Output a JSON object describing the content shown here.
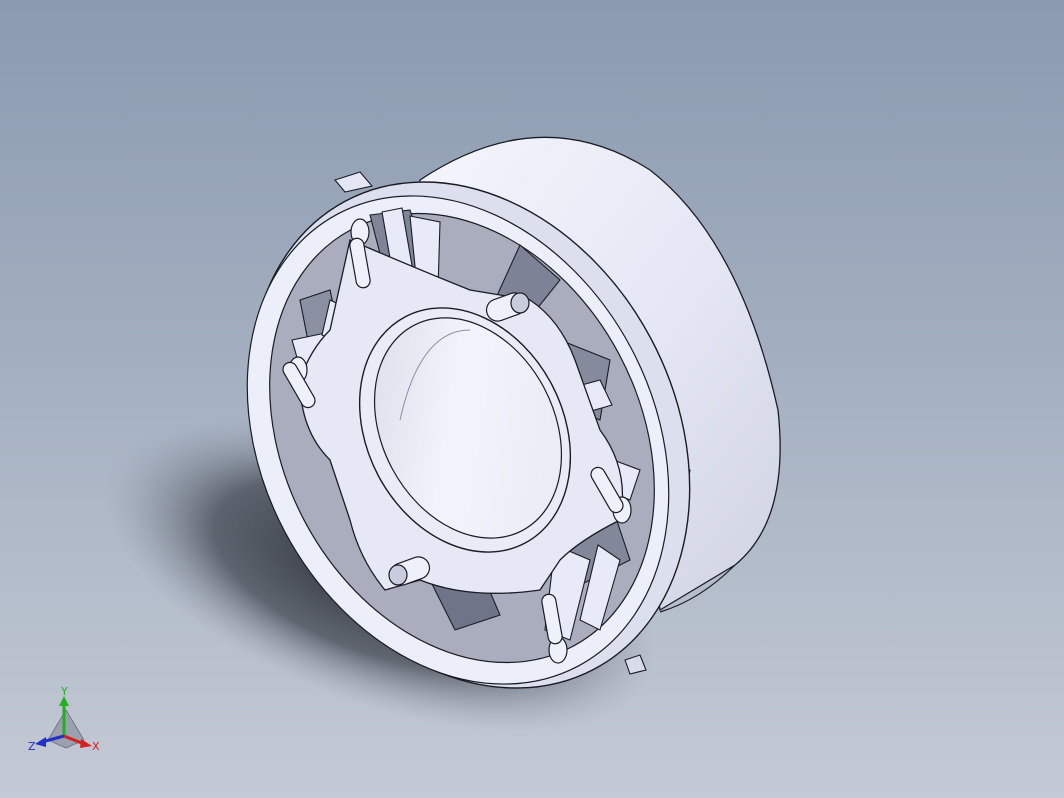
{
  "viewport": {
    "background_top": "#8b9ab0",
    "background_bottom": "#c4cad5"
  },
  "model": {
    "body_color": "#e9ecf9",
    "edge_color": "#1a1c24",
    "shade_color": "#b8bccc",
    "shadow_color": "#2a2e36"
  },
  "triad": {
    "x_label": "X",
    "y_label": "Y",
    "z_label": "Z",
    "x_color": "#d42020",
    "y_color": "#22b020",
    "z_color": "#2030c8"
  }
}
